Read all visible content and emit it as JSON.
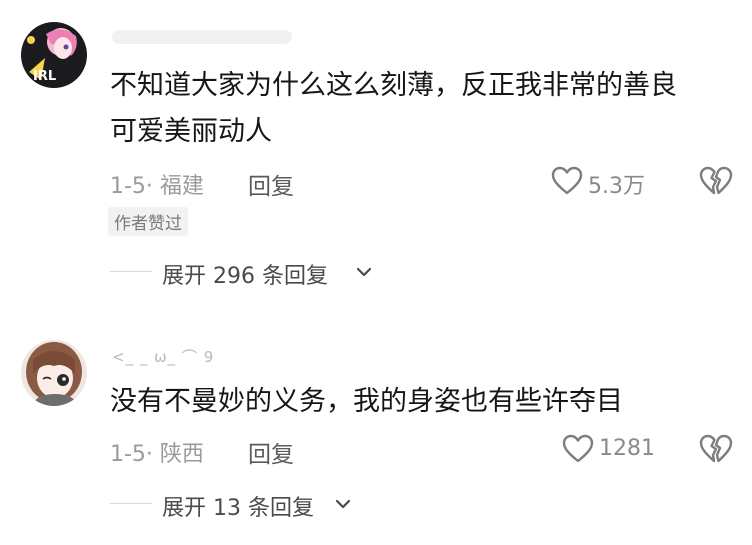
{
  "comments": [
    {
      "username": "",
      "text_line1": "不知道大家为什么这么刻薄，反正我非常的善良",
      "text_line2": "可爱美丽动人",
      "date_location": "1-5· 福建",
      "reply_label": "回复",
      "like_count": "5.3万",
      "author_badge": "作者赞过",
      "expand_label": "展开 296 条回复"
    },
    {
      "username": "<_ _ ω_ ⌒ 9",
      "text_line1": "没有不曼妙的义务，我的身姿也有些许夺目",
      "date_location": "1-5· 陕西",
      "reply_label": "回复",
      "like_count": "1281",
      "expand_label": "展开 13 条回复"
    }
  ],
  "icons": {
    "like": "heart-outline-icon",
    "dislike": "broken-heart-icon",
    "expand": "chevron-down-icon"
  }
}
